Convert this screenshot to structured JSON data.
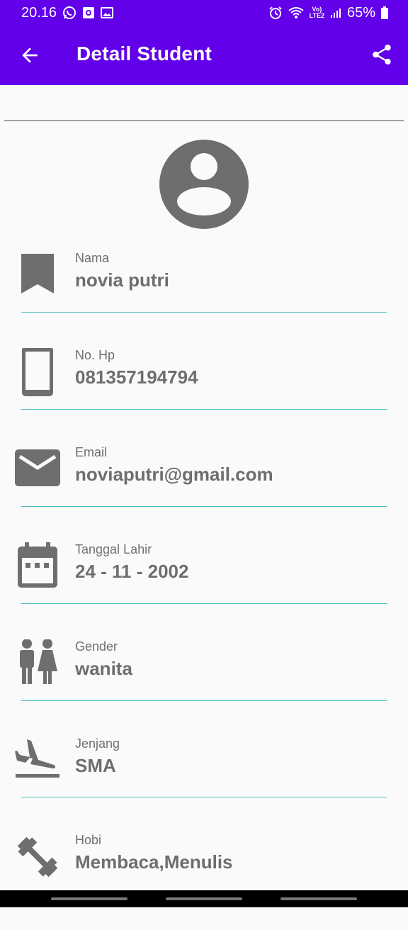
{
  "status_bar": {
    "time": "20.16",
    "net_top": "Vo)",
    "net_bottom": "LTE2",
    "battery": "65%"
  },
  "app_bar": {
    "title": "Detail Student"
  },
  "fields": [
    {
      "label": "Nama",
      "value": "novia  putri",
      "icon": "bookmark-icon"
    },
    {
      "label": "No. Hp",
      "value": "081357194794",
      "icon": "phone-icon"
    },
    {
      "label": "Email",
      "value": "noviaputri@gmail.com",
      "icon": "email-icon"
    },
    {
      "label": "Tanggal Lahir",
      "value": "24 - 11 - 2002",
      "icon": "calendar-icon"
    },
    {
      "label": "Gender",
      "value": "wanita",
      "icon": "people-icon"
    },
    {
      "label": "Jenjang",
      "value": "SMA",
      "icon": "airplane-icon"
    },
    {
      "label": "Hobi",
      "value": "Membaca,Menulis",
      "icon": "dumbbell-icon"
    }
  ],
  "colors": {
    "primary": "#6200ea",
    "icon_gray": "#6e6e6e",
    "underline": "#4fc1c1"
  }
}
